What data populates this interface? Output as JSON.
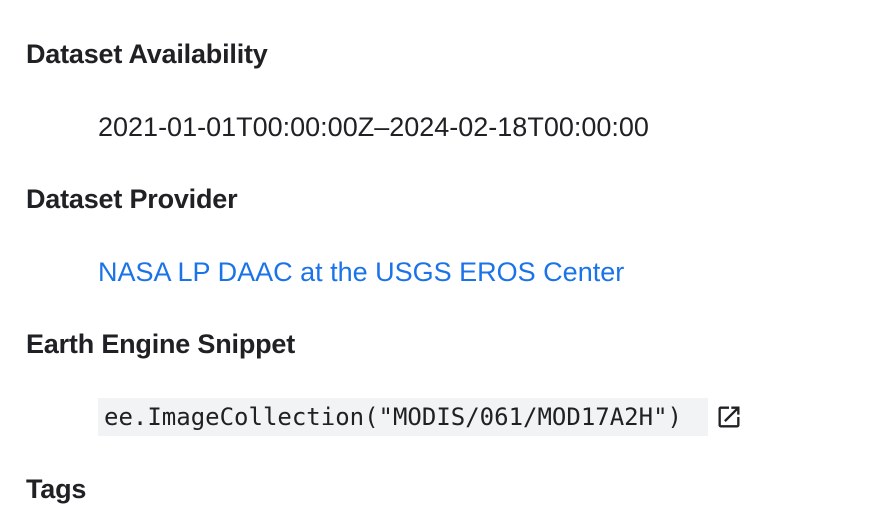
{
  "sections": {
    "availability": {
      "heading": "Dataset Availability",
      "value": "2021-01-01T00:00:00Z–2024-02-18T00:00:00"
    },
    "provider": {
      "heading": "Dataset Provider",
      "link_text": "NASA LP DAAC at the USGS EROS Center"
    },
    "snippet": {
      "heading": "Earth Engine Snippet",
      "code": "ee.ImageCollection(\"MODIS/061/MOD17A2H\")",
      "open_icon": "open-in-new-icon"
    },
    "tags": {
      "heading": "Tags"
    }
  },
  "colors": {
    "text": "#202124",
    "link": "#1a73e8",
    "code_background": "#f1f3f4"
  }
}
